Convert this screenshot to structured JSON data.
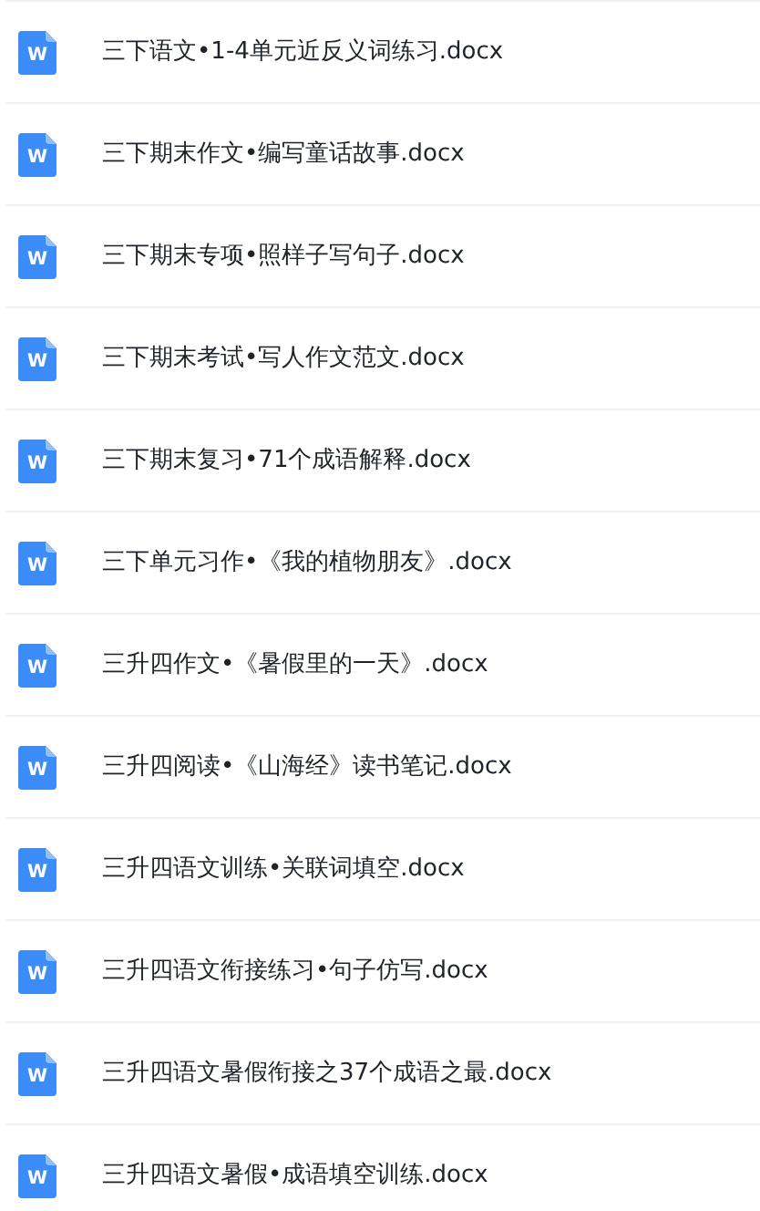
{
  "files": [
    {
      "name": "三下语文•1-4单元近反义词练习.docx",
      "icon_letter": "W"
    },
    {
      "name": "三下期末作文•编写童话故事.docx",
      "icon_letter": "W"
    },
    {
      "name": "三下期末专项•照样子写句子.docx",
      "icon_letter": "W"
    },
    {
      "name": "三下期末考试•写人作文范文.docx",
      "icon_letter": "W"
    },
    {
      "name": "三下期末复习•71个成语解释.docx",
      "icon_letter": "W"
    },
    {
      "name": "三下单元习作•《我的植物朋友》.docx",
      "icon_letter": "W"
    },
    {
      "name": "三升四作文•《暑假里的一天》.docx",
      "icon_letter": "W"
    },
    {
      "name": "三升四阅读•《山海经》读书笔记.docx",
      "icon_letter": "W"
    },
    {
      "name": "三升四语文训练•关联词填空.docx",
      "icon_letter": "W"
    },
    {
      "name": "三升四语文衔接练习•句子仿写.docx",
      "icon_letter": "W"
    },
    {
      "name": "三升四语文暑假衔接之37个成语之最.docx",
      "icon_letter": "W"
    },
    {
      "name": "三升四语文暑假•成语填空训练.docx",
      "icon_letter": "W"
    }
  ]
}
